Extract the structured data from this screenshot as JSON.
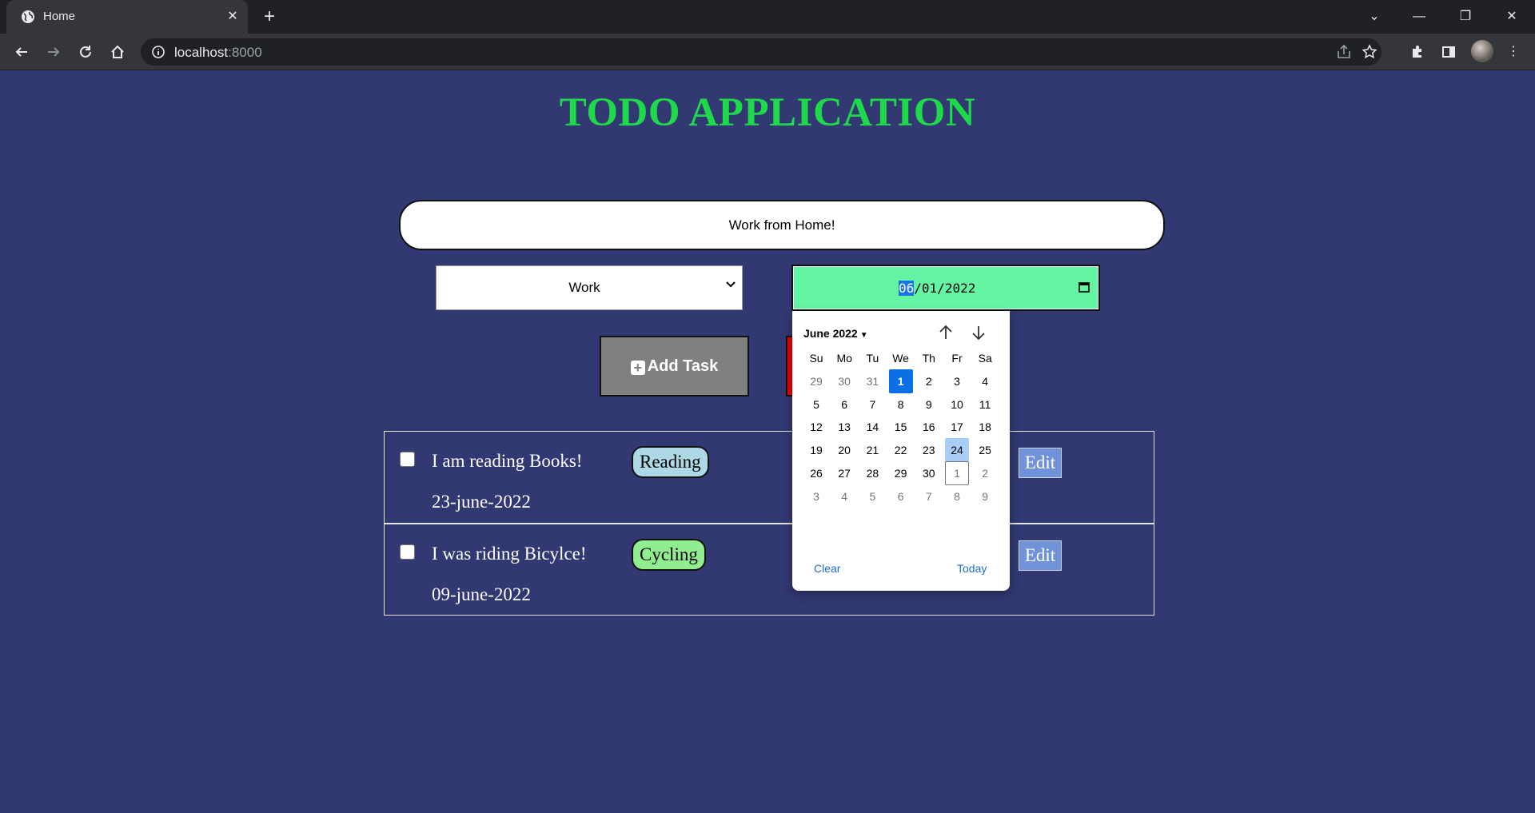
{
  "browser": {
    "tab_title": "Home",
    "url_host": "localhost",
    "url_port": ":8000"
  },
  "app": {
    "title": "TODO APPLICATION",
    "task_input_value": "Work from Home!",
    "category_value": "Work",
    "date_segments": {
      "month": "06",
      "day": "01",
      "year": "2022",
      "sep": "/"
    },
    "add_button_label": "Add Task"
  },
  "tasks": [
    {
      "text": "I am reading Books!",
      "tag": "Reading",
      "tag_color": "#add8e6",
      "date": "23-june-2022",
      "edit_label": "Edit",
      "checked": false
    },
    {
      "text": "I was riding Bicylce!",
      "tag": "Cycling",
      "tag_color": "#90ee90",
      "date": "09-june-2022",
      "edit_label": "Edit",
      "checked": false
    }
  ],
  "datepicker": {
    "month_label": "June 2022",
    "weekdays": [
      "Su",
      "Mo",
      "Tu",
      "We",
      "Th",
      "Fr",
      "Sa"
    ],
    "weeks": [
      [
        {
          "d": "29",
          "o": true
        },
        {
          "d": "30",
          "o": true
        },
        {
          "d": "31",
          "o": true
        },
        {
          "d": "1",
          "s": "sel"
        },
        {
          "d": "2"
        },
        {
          "d": "3"
        },
        {
          "d": "4"
        }
      ],
      [
        {
          "d": "5"
        },
        {
          "d": "6"
        },
        {
          "d": "7"
        },
        {
          "d": "8"
        },
        {
          "d": "9"
        },
        {
          "d": "10"
        },
        {
          "d": "11"
        }
      ],
      [
        {
          "d": "12"
        },
        {
          "d": "13"
        },
        {
          "d": "14"
        },
        {
          "d": "15"
        },
        {
          "d": "16"
        },
        {
          "d": "17"
        },
        {
          "d": "18"
        }
      ],
      [
        {
          "d": "19"
        },
        {
          "d": "20"
        },
        {
          "d": "21"
        },
        {
          "d": "22"
        },
        {
          "d": "23"
        },
        {
          "d": "24",
          "s": "hl"
        },
        {
          "d": "25"
        }
      ],
      [
        {
          "d": "26"
        },
        {
          "d": "27"
        },
        {
          "d": "28"
        },
        {
          "d": "29"
        },
        {
          "d": "30"
        },
        {
          "d": "1",
          "o": true,
          "s": "outlined"
        },
        {
          "d": "2",
          "o": true
        }
      ],
      [
        {
          "d": "3",
          "o": true
        },
        {
          "d": "4",
          "o": true
        },
        {
          "d": "5",
          "o": true
        },
        {
          "d": "6",
          "o": true
        },
        {
          "d": "7",
          "o": true
        },
        {
          "d": "8",
          "o": true
        },
        {
          "d": "9",
          "o": true
        }
      ]
    ],
    "clear_label": "Clear",
    "today_label": "Today"
  },
  "colors": {
    "page_bg": "#313872",
    "title_green": "#1ed94a",
    "date_input_bg": "#63f5a4",
    "add_button_bg": "#808080",
    "delete_button_bg": "#ee0000",
    "edit_button_bg": "#6f92d9",
    "selected_day": "#0b6fe6"
  }
}
